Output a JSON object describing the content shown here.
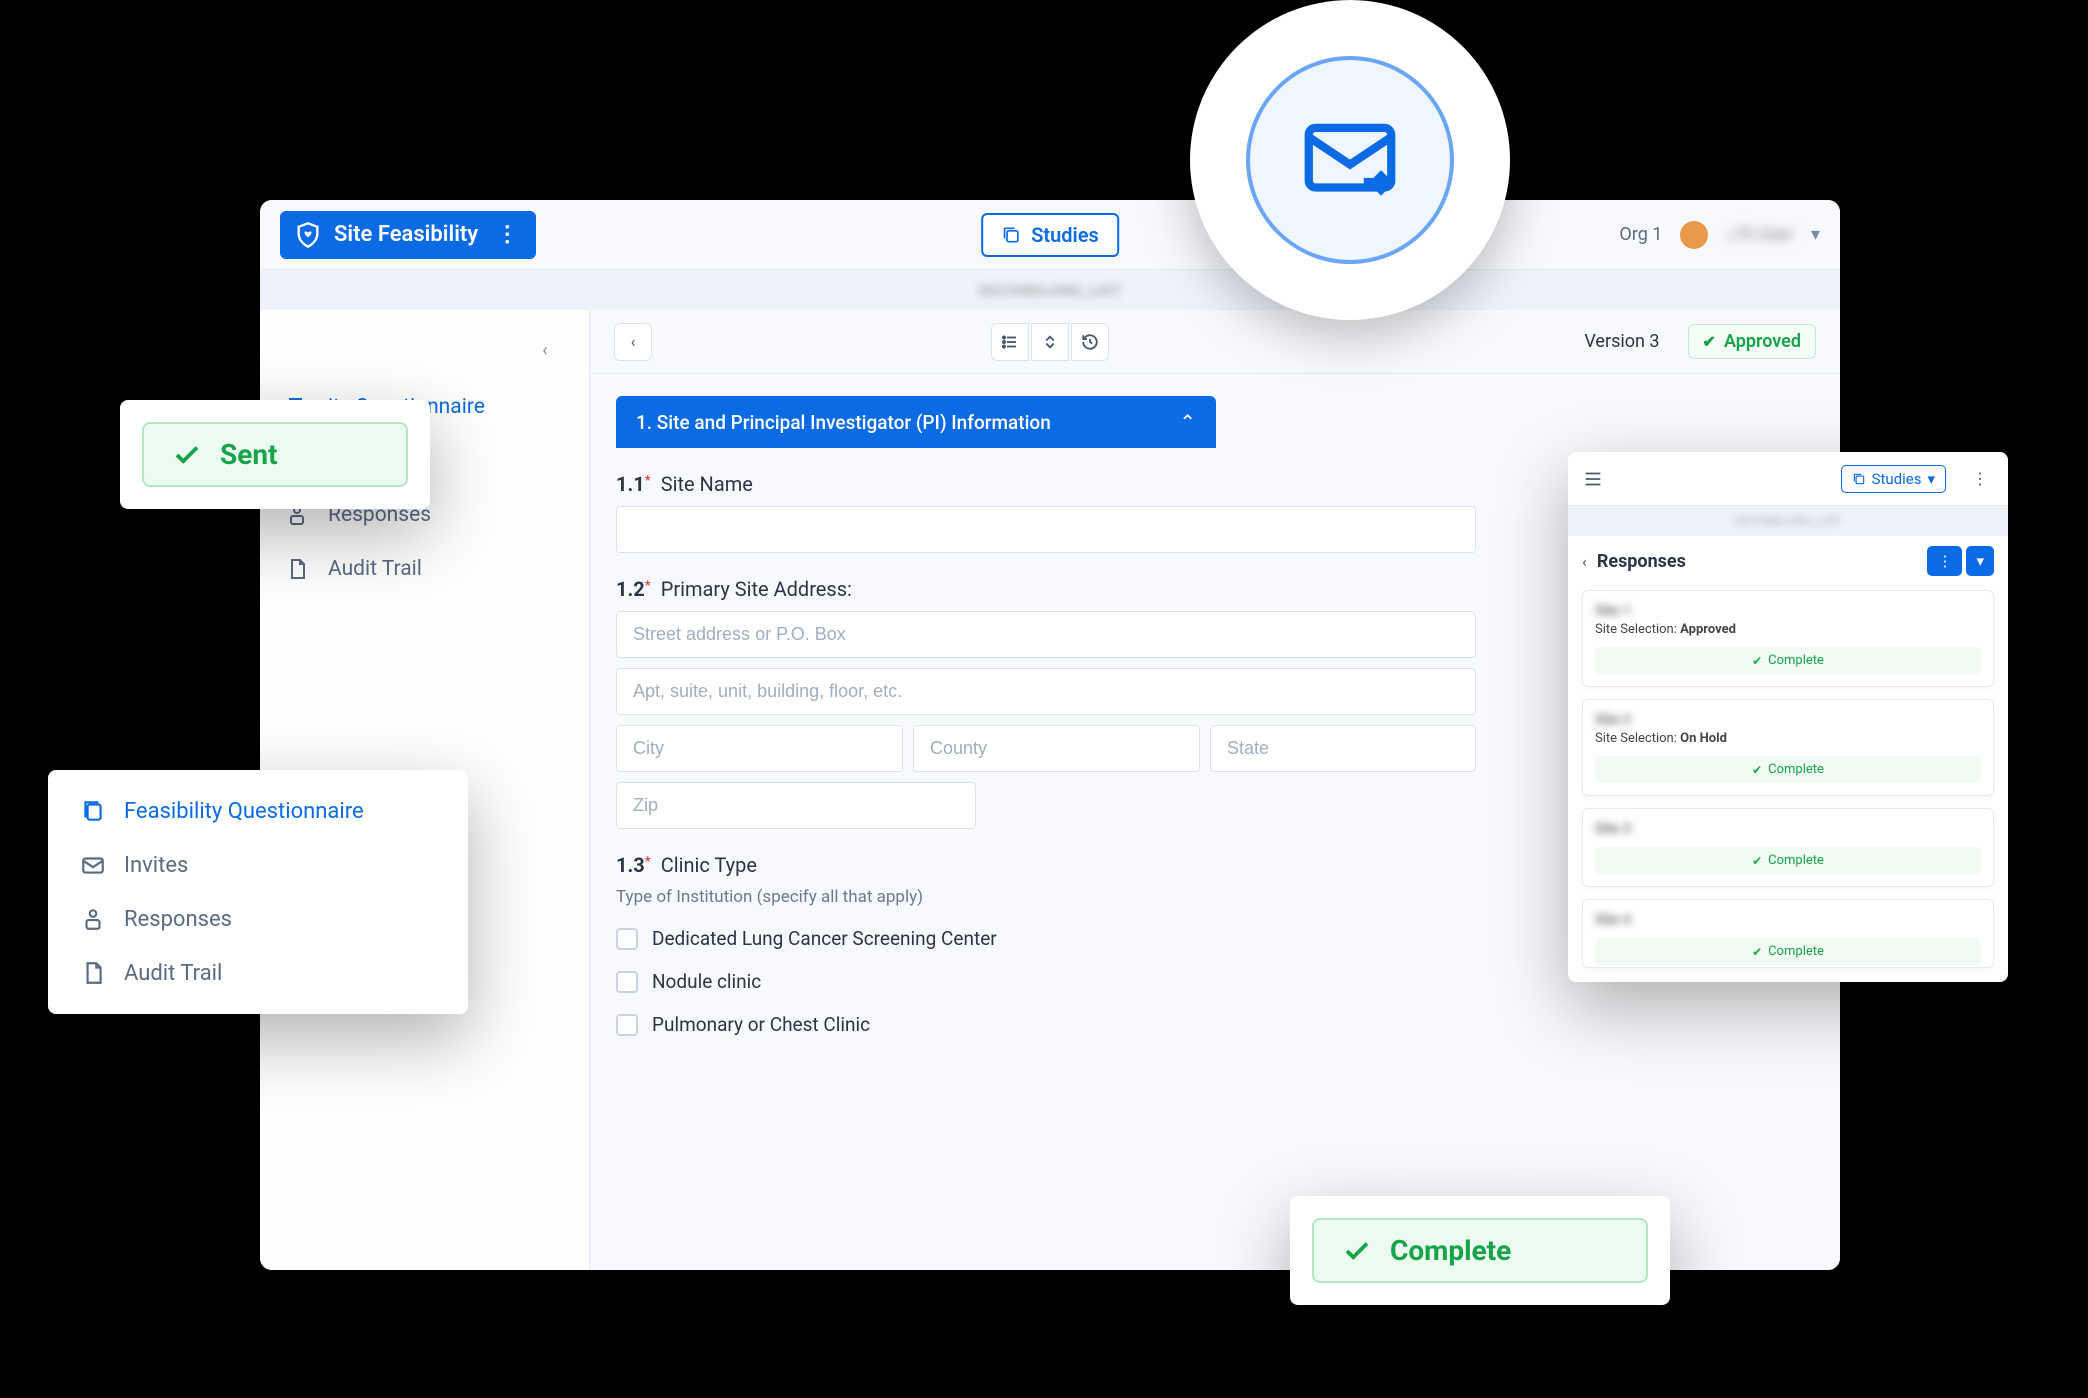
{
  "app": {
    "title": "Site Feasibility",
    "studies_btn": "Studies",
    "org": "Org 1",
    "user_name": "J R User",
    "version": "Version 3",
    "approved": "Approved"
  },
  "sidebar": {
    "items": [
      {
        "label": "Feasibility Questionnaire",
        "icon": "doc-icon"
      },
      {
        "label": "Invites",
        "icon": "mail-icon"
      },
      {
        "label": "Responses",
        "icon": "people-icon"
      },
      {
        "label": "Audit Trail",
        "icon": "page-icon"
      }
    ],
    "partial_active_text": "ity Questionnaire"
  },
  "section": {
    "title": "1. Site and Principal Investigator (PI) Information"
  },
  "q1": {
    "num": "1.1",
    "label": "Site Name"
  },
  "q2": {
    "num": "1.2",
    "label": "Primary Site Address:",
    "street_ph": "Street address or P.O. Box",
    "apt_ph": "Apt, suite, unit, building, floor, etc.",
    "city_ph": "City",
    "county_ph": "County",
    "state_ph": "State",
    "zip_ph": "Zip"
  },
  "q3": {
    "num": "1.3",
    "label": "Clinic Type",
    "hint": "Type of Institution (specify all that apply)",
    "opts": [
      "Dedicated Lung Cancer Screening Center",
      "Nodule clinic",
      "Pulmonary or Chest Clinic"
    ]
  },
  "sent_pill": "Sent",
  "complete_pill": "Complete",
  "mini": {
    "studies": "Studies",
    "title": "Responses",
    "site_selection_label": "Site Selection:",
    "cards": [
      {
        "name": "Site 1",
        "selection": "Approved",
        "status": "Complete"
      },
      {
        "name": "Site 2",
        "selection": "On Hold",
        "status": "Complete"
      },
      {
        "name": "Site 3",
        "selection": "",
        "status": "Complete"
      },
      {
        "name": "Site 4",
        "selection": "",
        "status": "Complete"
      }
    ]
  }
}
